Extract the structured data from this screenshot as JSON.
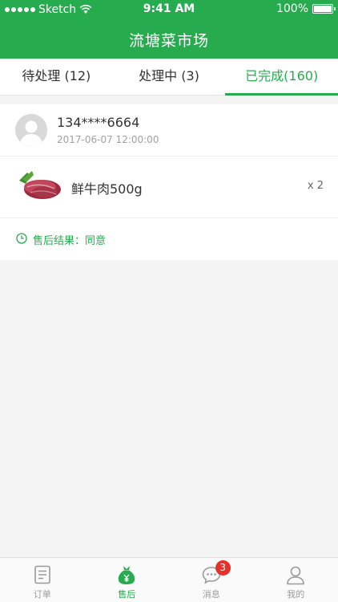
{
  "status_bar": {
    "carrier": "Sketch",
    "time": "9:41 AM",
    "battery": "100%"
  },
  "header": {
    "title": "流塘菜市场"
  },
  "tabs": [
    {
      "label": "待处理 (12)",
      "active": false
    },
    {
      "label": "处理中 (3)",
      "active": false
    },
    {
      "label": "已完成(160)",
      "active": true
    }
  ],
  "order": {
    "phone": "134****6664",
    "datetime": "2017-06-07 12:00:00",
    "product_name": "鲜牛肉500g",
    "quantity": "x 2",
    "result": "售后结果：同意"
  },
  "tabbar": {
    "items": [
      {
        "label": "订单",
        "icon": "order-icon",
        "active": false
      },
      {
        "label": "售后",
        "icon": "money-bag-icon",
        "active": true
      },
      {
        "label": "消息",
        "icon": "message-icon",
        "active": false,
        "badge": "3"
      },
      {
        "label": "我的",
        "icon": "profile-icon",
        "active": false
      }
    ]
  },
  "colors": {
    "brand": "#27ab4f",
    "badge": "#e8302a"
  }
}
